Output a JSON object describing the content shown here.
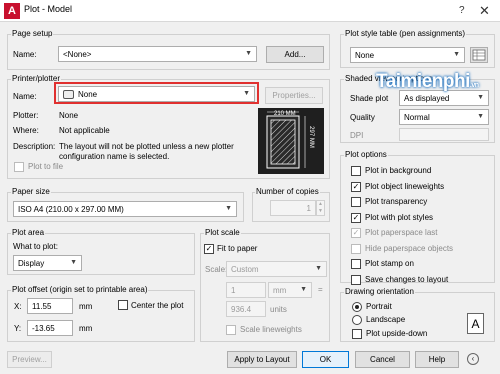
{
  "window": {
    "title": "Plot - Model",
    "help": "?",
    "close": "✕"
  },
  "page_setup": {
    "group": "Page setup",
    "name_label": "Name:",
    "name_value": "<None>",
    "add_button": "Add..."
  },
  "printer": {
    "group": "Printer/plotter",
    "name_label": "Name:",
    "name_value": "None",
    "properties_button": "Properties...",
    "plotter_label": "Plotter:",
    "plotter_value": "None",
    "where_label": "Where:",
    "where_value": "Not applicable",
    "description_label": "Description:",
    "description_value": "The layout will not be plotted unless a new plotter configuration name is selected.",
    "plot_to_file": "Plot to file",
    "preview_width": "210 MM",
    "preview_height": "297 MM"
  },
  "paper": {
    "group": "Paper size",
    "value": "ISO A4 (210.00 x 297.00 MM)"
  },
  "copies": {
    "group": "Number of copies",
    "value": "1"
  },
  "plot_area": {
    "group": "Plot area",
    "what_label": "What to plot:",
    "value": "Display"
  },
  "plot_offset": {
    "group": "Plot offset (origin set to printable area)",
    "x_label": "X:",
    "x_value": "11.55",
    "x_unit": "mm",
    "y_label": "Y:",
    "y_value": "-13.65",
    "y_unit": "mm",
    "center": "Center the plot"
  },
  "plot_scale": {
    "group": "Plot scale",
    "fit": "Fit to paper",
    "scale_label": "Scale:",
    "scale_value": "Custom",
    "num_value": "1",
    "num_unit": "mm",
    "den_value": "936.4",
    "den_unit": "units",
    "lineweights": "Scale lineweights",
    "equals": "="
  },
  "style_table": {
    "group": "Plot style table (pen assignments)",
    "value": "None"
  },
  "viewport": {
    "group": "Shaded viewport options",
    "shade_label": "Shade plot",
    "shade_value": "As displayed",
    "quality_label": "Quality",
    "quality_value": "Normal",
    "dpi_label": "DPI"
  },
  "plot_options": {
    "group": "Plot options",
    "items": [
      {
        "label": "Plot in background",
        "checked": false
      },
      {
        "label": "Plot object lineweights",
        "checked": true
      },
      {
        "label": "Plot transparency",
        "checked": false
      },
      {
        "label": "Plot with plot styles",
        "checked": true
      },
      {
        "label": "Plot paperspace last",
        "checked": true,
        "disabled": true
      },
      {
        "label": "Hide paperspace objects",
        "checked": false,
        "disabled": true
      },
      {
        "label": "Plot stamp on",
        "checked": false
      },
      {
        "label": "Save changes to layout",
        "checked": false
      }
    ]
  },
  "orientation": {
    "group": "Drawing orientation",
    "portrait": "Portrait",
    "landscape": "Landscape",
    "upside": "Plot upside-down",
    "icon_letter": "A"
  },
  "footer": {
    "preview": "Preview...",
    "apply": "Apply to Layout",
    "ok": "OK",
    "cancel": "Cancel",
    "help": "Help"
  },
  "watermark": {
    "brand": "Taimienphi",
    "domain": ".vn"
  }
}
